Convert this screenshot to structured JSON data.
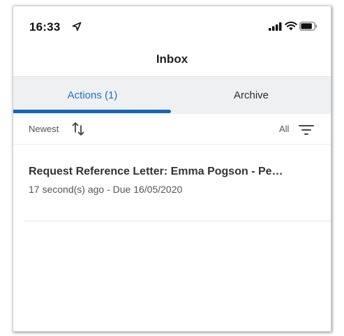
{
  "status_bar": {
    "time": "16:33",
    "location_icon": "location-arrow-icon",
    "signal_icon": "cellular-signal-icon",
    "wifi_icon": "wifi-icon",
    "battery_icon": "battery-icon"
  },
  "header": {
    "title": "Inbox"
  },
  "tabs": [
    {
      "label": "Actions (1)",
      "selected": true
    },
    {
      "label": "Archive",
      "selected": false
    }
  ],
  "filter_bar": {
    "sort_label": "Newest",
    "sort_icon": "sort-arrows-icon",
    "filter_label": "All",
    "filter_icon": "filter-lines-icon"
  },
  "inbox_items": [
    {
      "title": "Request Reference Letter: Emma Pogson - Pe…",
      "subtitle": "17 second(s) ago - Due 16/05/2020"
    }
  ],
  "colors": {
    "accent": "#1565c0",
    "active_tab_text": "#1a73c8",
    "tab_background": "#eef0f1"
  }
}
